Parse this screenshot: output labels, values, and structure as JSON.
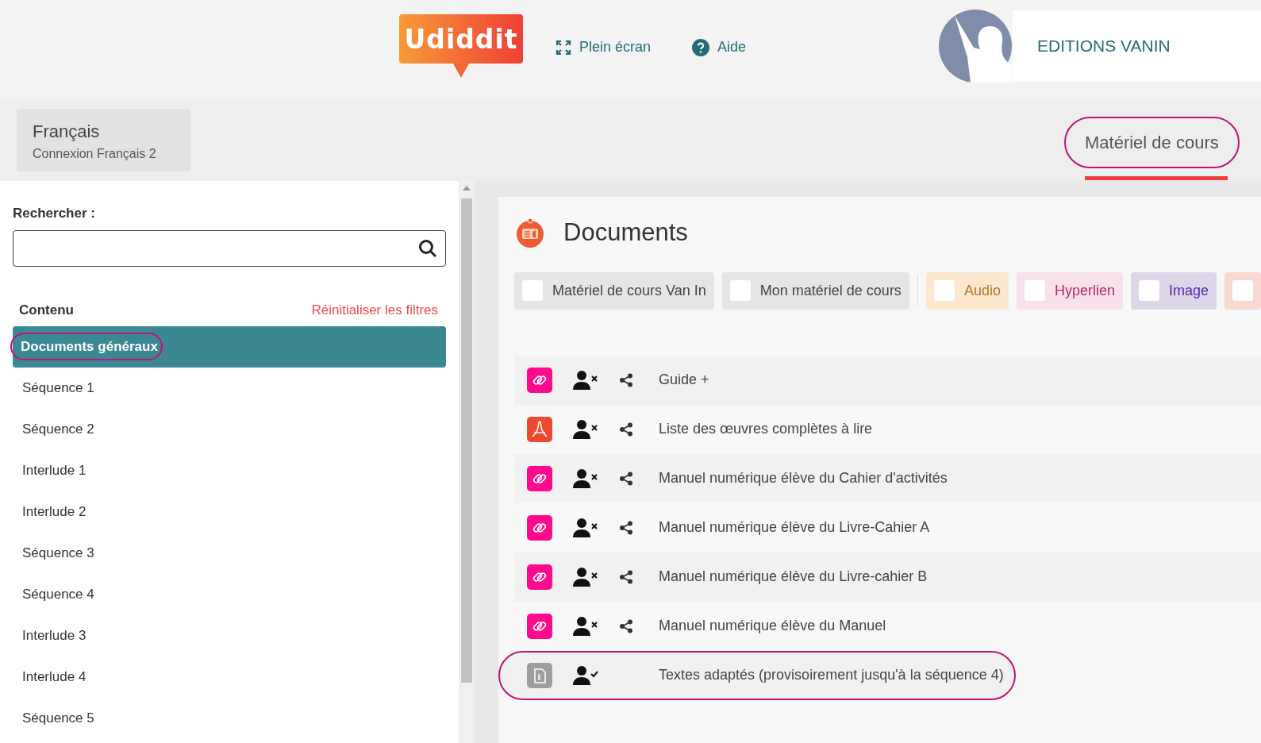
{
  "header": {
    "logo": "Udiddit",
    "links": [
      {
        "kind": "fullscreen",
        "label": "Plein écran"
      },
      {
        "kind": "help",
        "label": "Aide"
      }
    ],
    "account": "EDITIONS VANIN"
  },
  "course": {
    "title": "Français",
    "subtitle": "Connexion Français 2"
  },
  "tabs": [
    {
      "label": "Matériel de cours",
      "selected": true,
      "highlighted": true
    }
  ],
  "sidebar": {
    "search_label": "Rechercher :",
    "section": "Contenu",
    "reset": "Réinitialiser les filtres",
    "items": [
      {
        "label": "Documents généraux",
        "selected": true,
        "highlighted": true
      },
      {
        "label": "Séquence 1",
        "selected": false,
        "highlighted": false
      },
      {
        "label": "Séquence 2",
        "selected": false,
        "highlighted": false
      },
      {
        "label": "Interlude 1",
        "selected": false,
        "highlighted": false
      },
      {
        "label": "Interlude 2",
        "selected": false,
        "highlighted": false
      },
      {
        "label": "Séquence 3",
        "selected": false,
        "highlighted": false
      },
      {
        "label": "Séquence 4",
        "selected": false,
        "highlighted": false
      },
      {
        "label": "Interlude 3",
        "selected": false,
        "highlighted": false
      },
      {
        "label": "Interlude 4",
        "selected": false,
        "highlighted": false
      },
      {
        "label": "Séquence 5",
        "selected": false,
        "highlighted": false
      }
    ]
  },
  "documents": {
    "title": "Documents",
    "filters": [
      {
        "label": "Matériel de cours Van In",
        "checked": false,
        "color": "#e5e5e5"
      },
      {
        "label": "Mon matériel de cours",
        "checked": false,
        "color": "#e5e5e5"
      },
      {
        "label": "Audio",
        "checked": false,
        "color": "#fbe8cf"
      },
      {
        "label": "Hyperlien",
        "checked": false,
        "color": "#f8e1ea"
      },
      {
        "label": "Image",
        "checked": false,
        "color": "#dcd6e8"
      },
      {
        "checked": false,
        "color": "#f7d9d2"
      }
    ],
    "rows": [
      {
        "kind": "link",
        "title": "Guide +",
        "shared": false,
        "shareable": true,
        "highlighted": false
      },
      {
        "kind": "pdf",
        "title": "Liste des œuvres complètes à lire",
        "shared": false,
        "shareable": true,
        "highlighted": false
      },
      {
        "kind": "link",
        "title": "Manuel numérique élève du Cahier d'activités",
        "shared": false,
        "shareable": true,
        "highlighted": false
      },
      {
        "kind": "link",
        "title": "Manuel numérique élève du Livre-Cahier A",
        "shared": false,
        "shareable": true,
        "highlighted": false
      },
      {
        "kind": "link",
        "title": "Manuel numérique élève du Livre-cahier B",
        "shared": false,
        "shareable": true,
        "highlighted": false
      },
      {
        "kind": "link",
        "title": "Manuel numérique élève du Manuel",
        "shared": false,
        "shareable": true,
        "highlighted": false
      },
      {
        "kind": "file",
        "title": "Textes adaptés (provisoirement jusqu'à la séquence 4)",
        "shared": true,
        "shareable": false,
        "highlighted": true
      }
    ]
  }
}
